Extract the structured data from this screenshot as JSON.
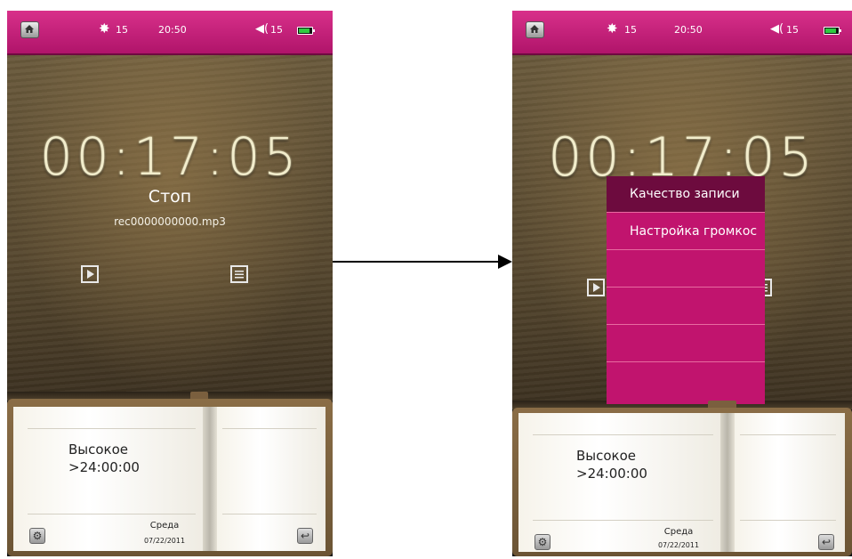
{
  "status": {
    "brightness": "15",
    "time": "20:50",
    "volume": "15"
  },
  "recorder": {
    "timer": "00:17:05",
    "state": "Стоп",
    "filename": "rec0000000000.mp3"
  },
  "book": {
    "quality": "Высокое",
    "remaining": ">24:00:00",
    "day": "Среда",
    "date": "07/22/2011"
  },
  "menu": {
    "items": [
      "Качество записи",
      "Настройка громкос",
      "",
      "",
      "",
      ""
    ]
  },
  "icons": {
    "home": "home-icon",
    "brightness": "sun-icon",
    "volume": "speaker-icon",
    "battery": "battery-icon",
    "play": "play-icon",
    "list": "list-icon",
    "settings": "gear-icon",
    "back": "return-icon"
  },
  "colors": {
    "status_bar": "#c2187a",
    "menu": "#c1146e",
    "menu_selected": "#6d0b3e"
  }
}
